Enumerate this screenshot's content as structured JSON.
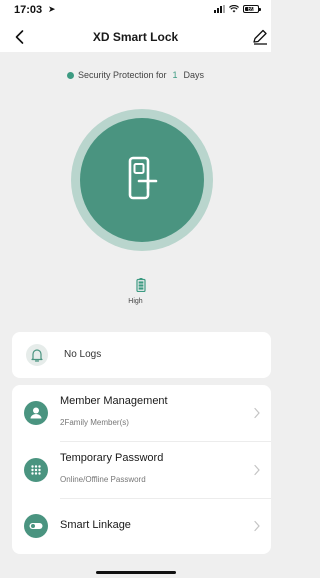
{
  "status_bar": {
    "time": "17:03",
    "location_arrow": "➤",
    "battery_text": "69"
  },
  "nav": {
    "title": "XD Smart Lock",
    "back_icon": "chevron-left",
    "edit_icon": "pencil"
  },
  "protection": {
    "prefix": "Security Protection for",
    "days": "1",
    "suffix": "Days"
  },
  "lock": {
    "icon": "door-lock",
    "battery_label": "High"
  },
  "logs": {
    "icon": "bell",
    "text": "No Logs"
  },
  "menu": [
    {
      "title": "Member Management",
      "subtitle": "2Family Member(s)",
      "icon": "person"
    },
    {
      "title": "Temporary Password",
      "subtitle": "Online/Offline Password",
      "icon": "keypad"
    },
    {
      "title": "Smart Linkage",
      "subtitle": "",
      "icon": "toggle"
    }
  ],
  "colors": {
    "accent": "#4a9480",
    "accent_light": "#b9d5cd",
    "background": "#efefef"
  }
}
